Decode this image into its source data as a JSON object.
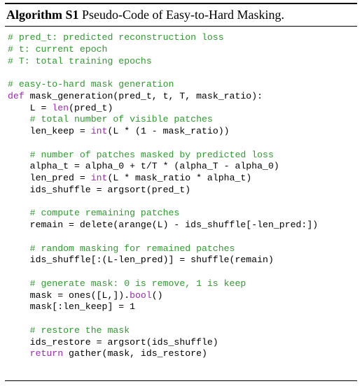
{
  "caption": {
    "label": "Algorithm S1",
    "title": "Pseudo-Code of Easy-to-Hard Masking."
  },
  "code": {
    "lines": [
      [
        {
          "t": "# pred_t: predicted reconstruction loss",
          "s": "c"
        }
      ],
      [
        {
          "t": "# t: current epoch",
          "s": "c"
        }
      ],
      [
        {
          "t": "# T: total training epochs",
          "s": "c"
        }
      ],
      [],
      [
        {
          "t": "# easy-to-hard mask generation",
          "s": "c"
        }
      ],
      [
        {
          "t": "def",
          "s": "k"
        },
        {
          "t": " mask_generation(pred_t, t, T, mask_ratio):",
          "s": ""
        }
      ],
      [
        {
          "t": "    L = ",
          "s": ""
        },
        {
          "t": "len",
          "s": "k"
        },
        {
          "t": "(pred_t)",
          "s": ""
        }
      ],
      [
        {
          "t": "    ",
          "s": ""
        },
        {
          "t": "# total number of visible patches",
          "s": "c"
        }
      ],
      [
        {
          "t": "    len_keep = ",
          "s": ""
        },
        {
          "t": "int",
          "s": "k"
        },
        {
          "t": "(L * (1 - mask_ratio))",
          "s": ""
        }
      ],
      [],
      [
        {
          "t": "    ",
          "s": ""
        },
        {
          "t": "# number of patches masked by predicted loss",
          "s": "c"
        }
      ],
      [
        {
          "t": "    alpha_t = alpha_0 + t/T * (alpha_T - alpha_0)",
          "s": ""
        }
      ],
      [
        {
          "t": "    len_pred = ",
          "s": ""
        },
        {
          "t": "int",
          "s": "k"
        },
        {
          "t": "(L * mask_ratio * alpha_t)",
          "s": ""
        }
      ],
      [
        {
          "t": "    ids_shuffle = argsort(pred_t)",
          "s": ""
        }
      ],
      [],
      [
        {
          "t": "    ",
          "s": ""
        },
        {
          "t": "# compute remaining patches",
          "s": "c"
        }
      ],
      [
        {
          "t": "    remain = delete(arange(L) - ids_shuffle[-len_pred:])",
          "s": ""
        }
      ],
      [],
      [
        {
          "t": "    ",
          "s": ""
        },
        {
          "t": "# random masking for remained patches",
          "s": "c"
        }
      ],
      [
        {
          "t": "    ids_shuffle[:(L-len_pred)] = shuffle(remain)",
          "s": ""
        }
      ],
      [],
      [
        {
          "t": "    ",
          "s": ""
        },
        {
          "t": "# generate mask: 0 is remove, 1 is keep",
          "s": "c"
        }
      ],
      [
        {
          "t": "    mask = ones([L,]).",
          "s": ""
        },
        {
          "t": "bool",
          "s": "k"
        },
        {
          "t": "()",
          "s": ""
        }
      ],
      [
        {
          "t": "    mask[:len_keep] = 1",
          "s": ""
        }
      ],
      [],
      [
        {
          "t": "    ",
          "s": ""
        },
        {
          "t": "# restore the mask",
          "s": "c"
        }
      ],
      [
        {
          "t": "    ids_restore = argsort(ids_shuffle)",
          "s": ""
        }
      ],
      [
        {
          "t": "    ",
          "s": ""
        },
        {
          "t": "return",
          "s": "k"
        },
        {
          "t": " gather(mask, ids_restore)",
          "s": ""
        }
      ]
    ]
  },
  "colors": {
    "comment": "#2e9a2e",
    "keyword": "#9a2bb0",
    "text": "#000000"
  }
}
